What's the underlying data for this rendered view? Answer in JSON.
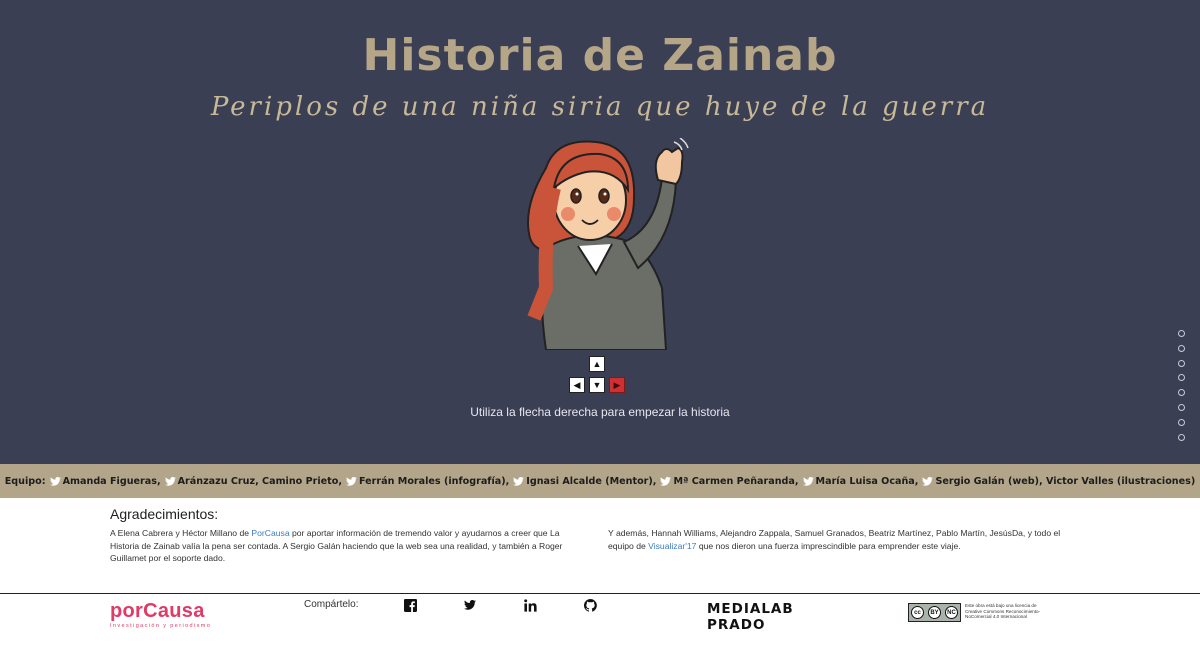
{
  "hero": {
    "title": "Historia de Zainab",
    "subtitle": "Periplos de una niña siria que huye de la guerra",
    "instructions": "Utiliza la flecha derecha para empezar la historia",
    "keys": {
      "up": "▲",
      "left": "◀",
      "down": "▼",
      "right": "▶"
    },
    "slide_count": 8
  },
  "team": {
    "label": "Equipo:",
    "members": [
      "Amanda Figueras,",
      "Aránzazu Cruz, Camino Prieto,",
      "Ferrán Morales (infografía),",
      "Ignasi Alcalde (Mentor),",
      "Mª Carmen Peñaranda,",
      "María Luisa Ocaña,",
      "Sergio Galán (web), Victor Valles (ilustraciones)"
    ]
  },
  "thanks": {
    "title": "Agradecimientos:",
    "col1": {
      "pre": "A Elena Cabrera y Héctor Millano de ",
      "link": "PorCausa",
      "post": " por aportar información de tremendo valor y ayudarnos a creer que La Historia de Zainab valía la pena ser contada. A Sergio Galán haciendo que la web sea una realidad, y también a Roger Guillamet por el soporte dado."
    },
    "col2": {
      "pre": "Y además, Hannah Williams, Alejandro Zappala, Samuel Granados, Beatriz Martínez, Pablo Martín, JesúsDa, y todo el equipo de ",
      "link": "Visualizar'17",
      "post": " que nos dieron una fuerza imprescindible para emprender este viaje."
    }
  },
  "footer": {
    "brand_name": "porCausa",
    "brand_tagline": "Investigación y periodismo",
    "share_label": "Compártelo:",
    "medialab_line1": "MEDIALAB",
    "medialab_line2": "PRADO",
    "cc_symbols": [
      "cc",
      "BY",
      "NC"
    ],
    "license_text": "Este obra está bajo una licencia de Creative Commons Reconocimiento-NoComercial 4.0 Internacional"
  },
  "colors": {
    "hero_bg": "#3b3f54",
    "title": "#b6a688",
    "team_bar": "#b2a58a",
    "accent_red": "#d23030",
    "brand_pink": "#e03a66",
    "link": "#3a7bc8"
  }
}
